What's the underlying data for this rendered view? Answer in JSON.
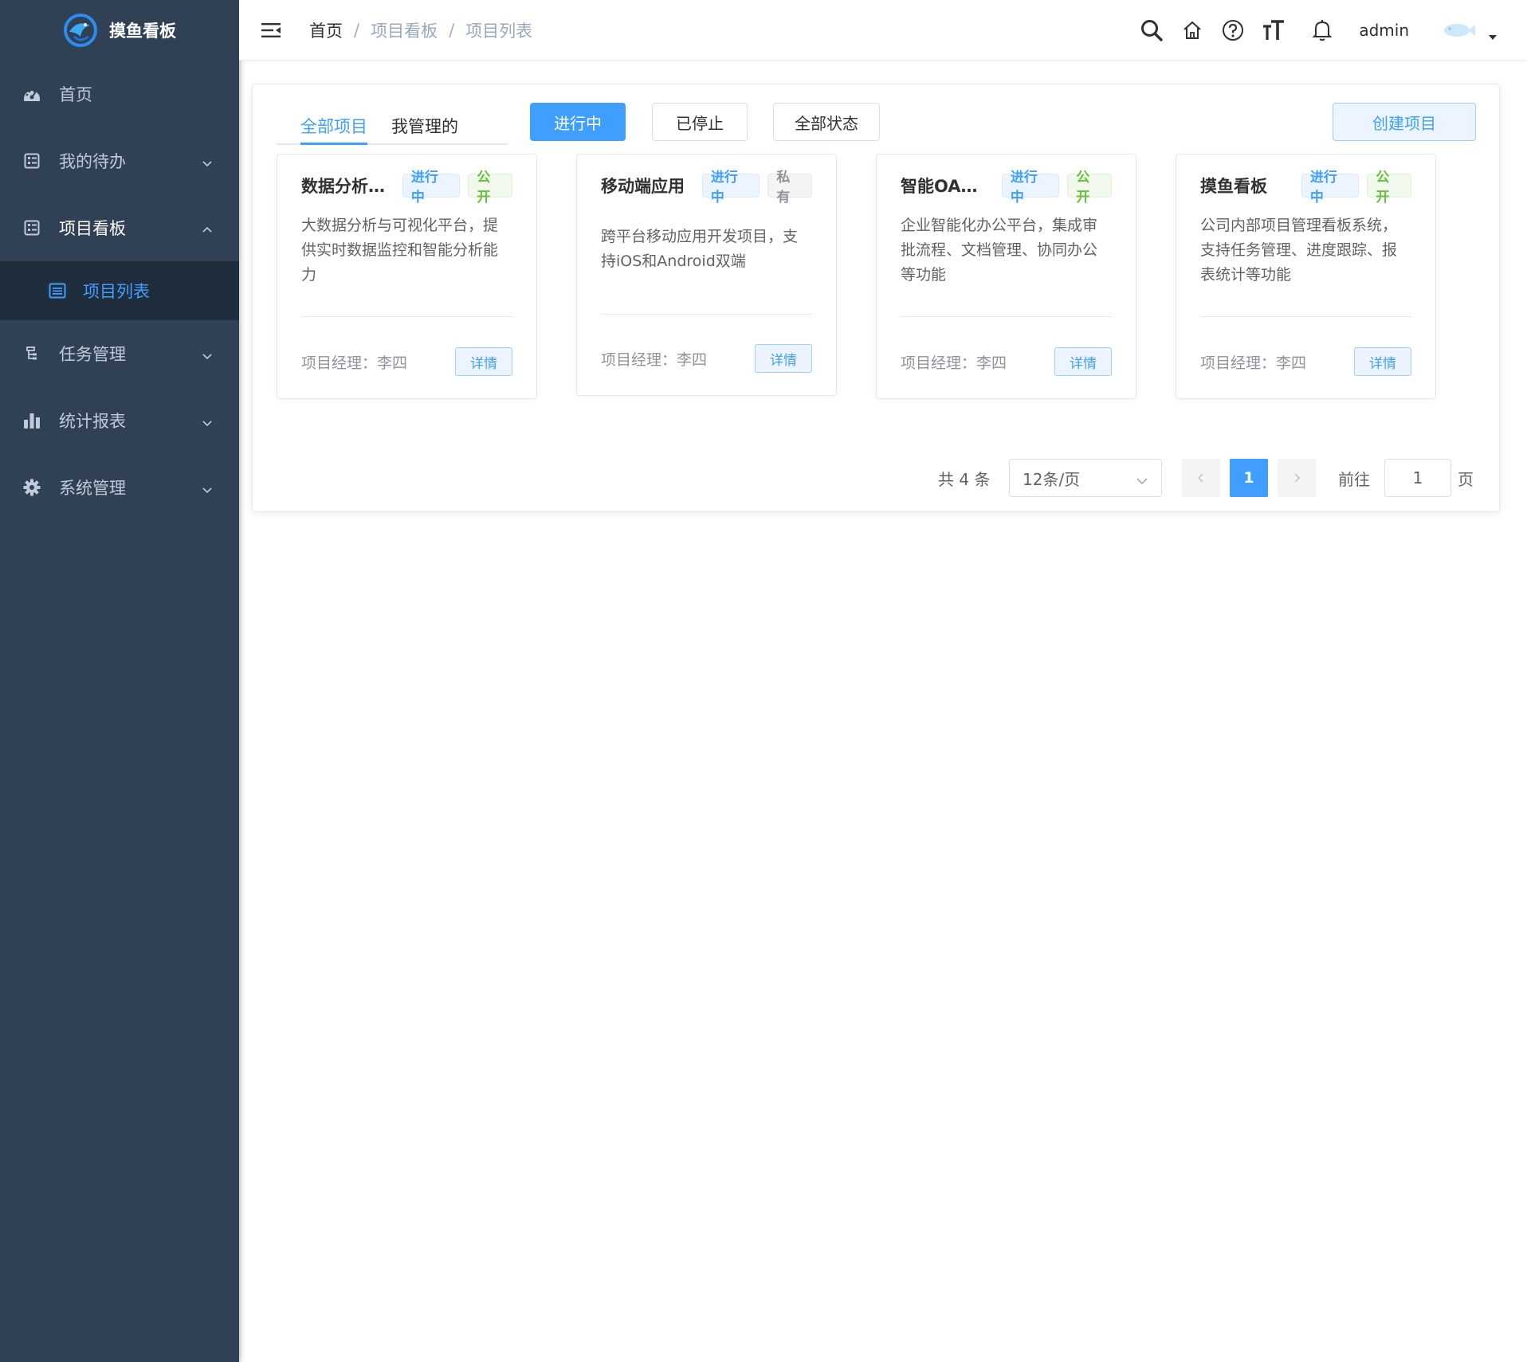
{
  "app": {
    "title": "摸鱼看板"
  },
  "sidebar": {
    "items": [
      {
        "label": "首页",
        "icon": "dashboard-icon"
      },
      {
        "label": "我的待办",
        "icon": "todo-icon"
      },
      {
        "label": "项目看板",
        "icon": "board-icon"
      },
      {
        "label": "项目列表",
        "icon": "list-icon"
      },
      {
        "label": "任务管理",
        "icon": "tree-icon"
      },
      {
        "label": "统计报表",
        "icon": "bar-chart-icon"
      },
      {
        "label": "系统管理",
        "icon": "gear-icon"
      }
    ]
  },
  "header": {
    "breadcrumb": [
      "首页",
      "项目看板",
      "项目列表"
    ],
    "username": "admin"
  },
  "toolbar": {
    "tabs": [
      "全部项目",
      "我管理的"
    ],
    "filters": {
      "running": "进行中",
      "stopped": "已停止",
      "all": "全部状态"
    },
    "create_label": "创建项目"
  },
  "projects": [
    {
      "title": "数据分析平台",
      "status": "进行中",
      "visibility": "公开",
      "description": "大数据分析与可视化平台，提供实时数据监控和智能分析能力",
      "manager": "项目经理：李四",
      "detail_label": "详情"
    },
    {
      "title": "移动端应用",
      "status": "进行中",
      "visibility": "私有",
      "description": "跨平台移动应用开发项目，支持iOS和Android双端",
      "manager": "项目经理：李四",
      "detail_label": "详情"
    },
    {
      "title": "智能OA系统",
      "status": "进行中",
      "visibility": "公开",
      "description": "企业智能化办公平台，集成审批流程、文档管理、协同办公等功能",
      "manager": "项目经理：李四",
      "detail_label": "详情"
    },
    {
      "title": "摸鱼看板",
      "status": "进行中",
      "visibility": "公开",
      "description": "公司内部项目管理看板系统，支持任务管理、进度跟踪、报表统计等功能",
      "manager": "项目经理：李四",
      "detail_label": "详情"
    }
  ],
  "pagination": {
    "total": "共 4 条",
    "page_size": "12条/页",
    "current_page": "1",
    "goto_label": "前往",
    "goto_value": "1",
    "goto_suffix": "页"
  },
  "colors": {
    "primary": "#409eff",
    "sidebar_bg": "#304156",
    "submenu_bg": "#1f2d3d",
    "success": "#67c23a"
  }
}
